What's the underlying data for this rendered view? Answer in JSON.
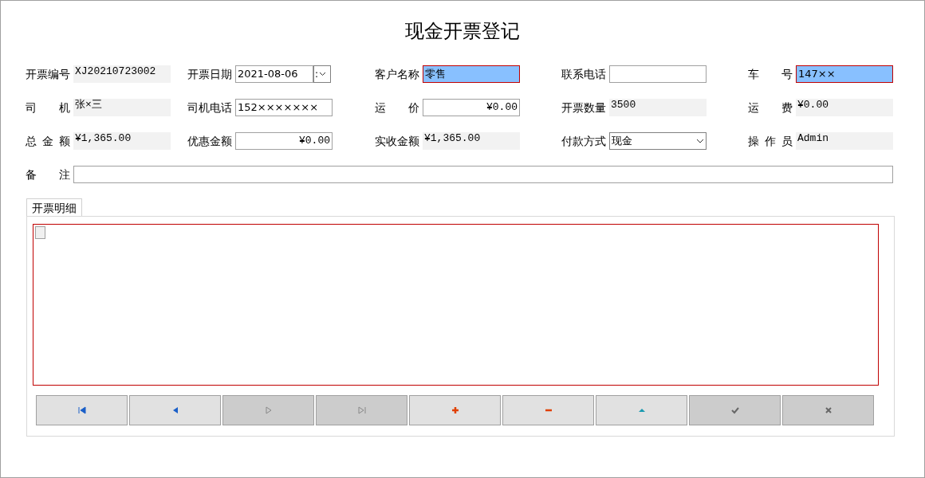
{
  "window": {
    "title": "现金开票登记"
  },
  "fields": [
    {
      "label": "开票编号",
      "kind": "readonly",
      "value": "XJ20210723002"
    },
    {
      "label": "开票日期",
      "kind": "date",
      "value": "2021-08-06",
      "spin_text": ":",
      "selected": false
    },
    {
      "label": "客户名称",
      "kind": "input",
      "value": "零售",
      "selected": true
    },
    {
      "label": "联系电话",
      "kind": "input",
      "selected": false
    },
    {
      "label": "车 号",
      "kind": "input",
      "value": "147××",
      "selected": true
    },
    {
      "label": "司 机",
      "kind": "readonly",
      "value": "张×三"
    },
    {
      "label": "司机电话",
      "kind": "input",
      "value": "152×××××××",
      "selected": false
    },
    {
      "label": "运 价",
      "kind": "money",
      "value": "¥0.00",
      "selected": false
    },
    {
      "label": "开票数量",
      "kind": "readonly",
      "value": "3500"
    },
    {
      "label": "运 费",
      "kind": "readonly",
      "value": "¥0.00"
    },
    {
      "label": "总 金 额",
      "kind": "readonly",
      "value": "¥1,365.00"
    },
    {
      "label": "优惠金额",
      "kind": "money",
      "value": "¥0.00",
      "selected": false
    },
    {
      "label": "实收金额",
      "kind": "readonly",
      "value": "¥1,365.00"
    },
    {
      "label": "付款方式",
      "kind": "combo",
      "value": "现金",
      "selected": false
    },
    {
      "label": "操 作 员",
      "kind": "readonly",
      "value": "Admin"
    }
  ],
  "notes": {
    "label": "备 注"
  },
  "tabs": [
    {
      "label": "开票明细",
      "selected": true
    }
  ],
  "nav_buttons": [
    {
      "kind": "first",
      "disabled": false
    },
    {
      "kind": "prev",
      "disabled": false
    },
    {
      "kind": "next",
      "disabled": true
    },
    {
      "kind": "last",
      "disabled": true
    },
    {
      "kind": "add",
      "disabled": false
    },
    {
      "kind": "delete",
      "disabled": false
    },
    {
      "kind": "up",
      "disabled": false
    },
    {
      "kind": "save",
      "disabled": true
    },
    {
      "kind": "cancel",
      "disabled": true
    }
  ]
}
